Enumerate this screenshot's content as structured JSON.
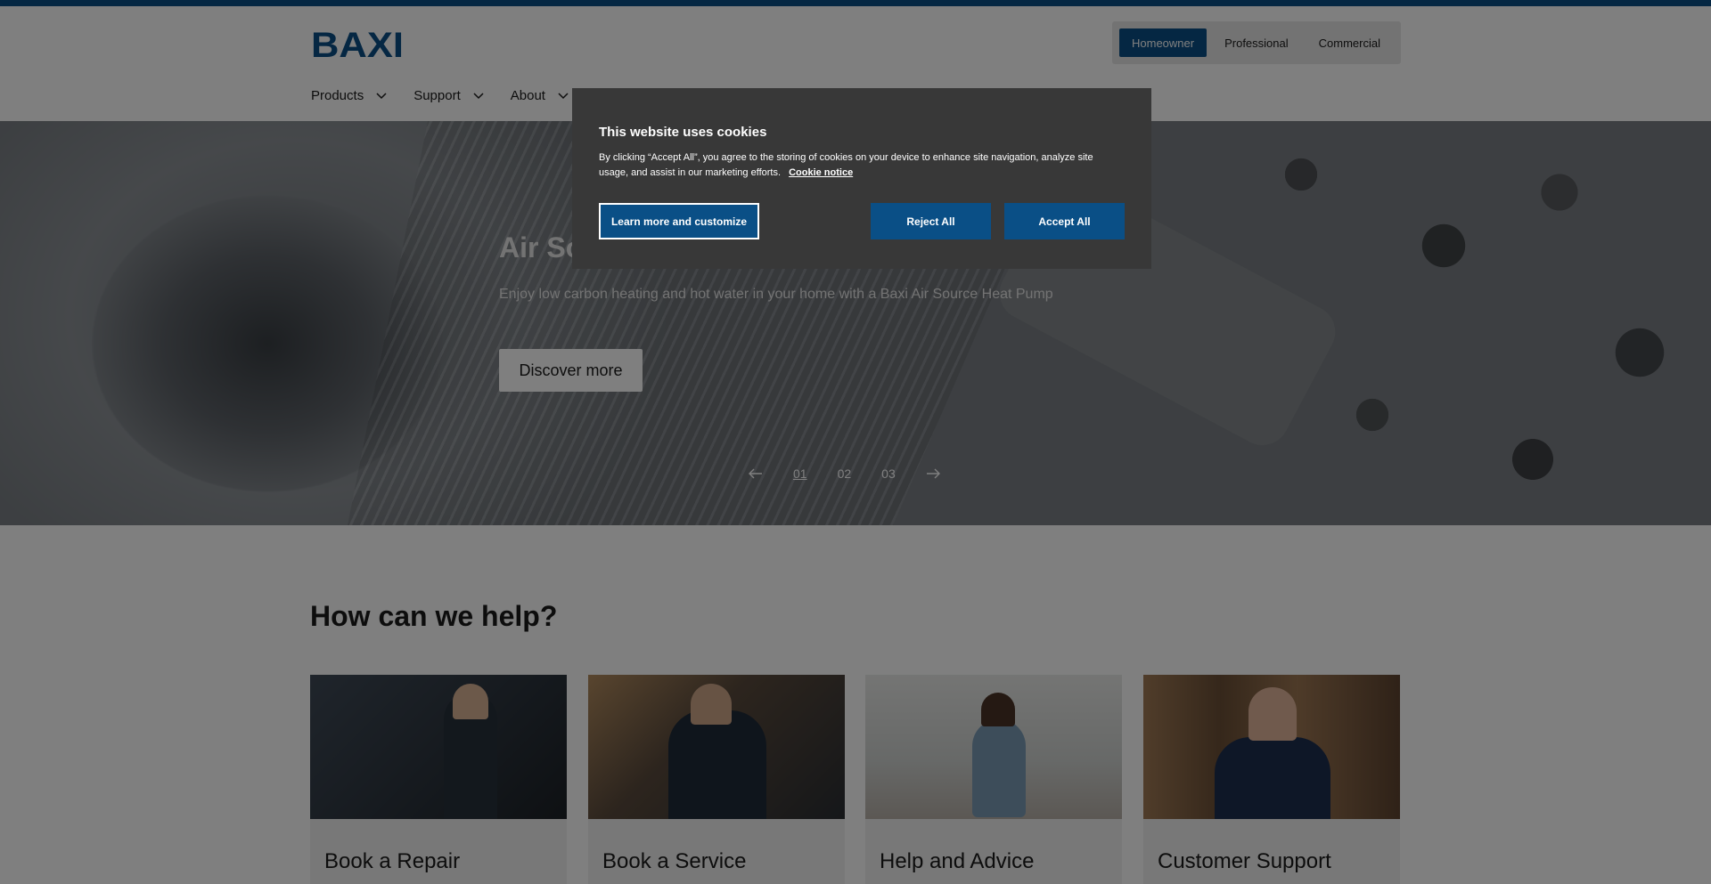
{
  "brand": {
    "logo_text": "BAXI",
    "color": "#0a4f86"
  },
  "audience": {
    "items": [
      "Homeowner",
      "Professional",
      "Commercial"
    ],
    "active": "Homeowner"
  },
  "nav": {
    "items": [
      "Products",
      "Support",
      "About"
    ]
  },
  "hero": {
    "title": "Air So",
    "subtitle": "Enjoy low carbon heating and hot water in your home with a Baxi Air Source Heat Pump",
    "cta": "Discover more",
    "slides": [
      "01",
      "02",
      "03"
    ],
    "current_slide": "01"
  },
  "help": {
    "title": "How can we help?",
    "cards": [
      {
        "title": "Book a Repair"
      },
      {
        "title": "Book a Service"
      },
      {
        "title": "Help and Advice"
      },
      {
        "title": "Customer Support"
      }
    ]
  },
  "cookie": {
    "title": "This website uses cookies",
    "text": "By clicking “Accept All”, you agree to the storing of cookies on your device to enhance site navigation, analyze site usage, and assist in our marketing efforts.",
    "link": "Cookie notice",
    "learn_more": "Learn more and customize",
    "reject": "Reject All",
    "accept": "Accept All"
  },
  "icons": {
    "nav_chevron": "chevron-down-icon",
    "prev": "arrow-left-icon",
    "next": "arrow-right-icon"
  }
}
